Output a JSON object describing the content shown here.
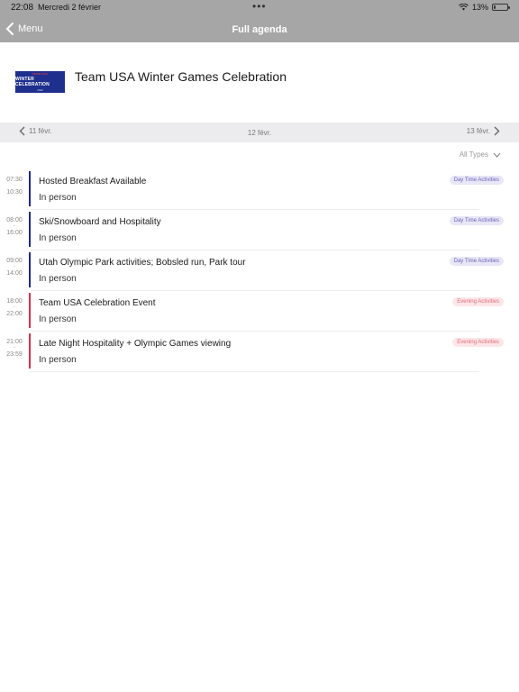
{
  "status_bar": {
    "time": "22:08",
    "date": "Mercredi 2 février",
    "dots": "•••",
    "battery_text": "13%",
    "battery_level": 0.13
  },
  "nav": {
    "back_label": "Menu",
    "title": "Full agenda"
  },
  "event": {
    "title": "Team USA Winter Games Celebration",
    "logo": {
      "line1": "TEAM USA",
      "line2": "WINTER CELEBRATION",
      "line3": "2022"
    }
  },
  "date_nav": {
    "prev": "11 févr.",
    "current": "12 févr.",
    "next": "13 févr."
  },
  "filter": {
    "label": "All Types"
  },
  "colors": {
    "day": "#1c2a8c",
    "evening": "#d6334a",
    "day_badge_bg": "#e8e6f7",
    "day_badge_text": "#6a63b8",
    "evening_badge_bg": "#fde6e8",
    "evening_badge_text": "#e36a7a"
  },
  "sessions": [
    {
      "start": "07:30",
      "end": "10:30",
      "title": "Hosted Breakfast Available",
      "location": "In person",
      "type": "Day Time Activities",
      "kind": "day"
    },
    {
      "start": "08:00",
      "end": "16:00",
      "title": "Ski/Snowboard and Hospitality",
      "location": "In person",
      "type": "Day Time Activities",
      "kind": "day"
    },
    {
      "start": "09:00",
      "end": "14:00",
      "title": "Utah Olympic Park activities; Bobsled run, Park tour",
      "location": "In person",
      "type": "Day Time Activities",
      "kind": "day"
    },
    {
      "start": "18:00",
      "end": "22:00",
      "title": "Team USA Celebration Event",
      "location": "In person",
      "type": "Evening Activities",
      "kind": "evening"
    },
    {
      "start": "21:00",
      "end": "23:59",
      "title": "Late Night Hospitality + Olympic Games viewing",
      "location": "In person",
      "type": "Evening Activities",
      "kind": "evening"
    }
  ]
}
